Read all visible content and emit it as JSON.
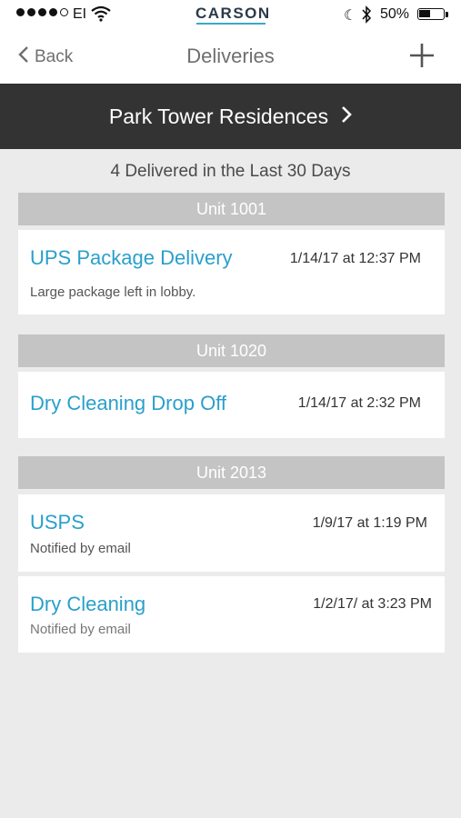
{
  "status_bar": {
    "carrier": "EI",
    "brand": "CARSON",
    "battery_percent": "50%",
    "battery_level": 0.5
  },
  "nav": {
    "back_label": "Back",
    "title": "Deliveries",
    "add_icon": "plus-icon"
  },
  "property": {
    "name": "Park Tower Residences"
  },
  "summary": "4 Delivered in the Last 30 Days",
  "units": [
    {
      "name": "Unit 1001",
      "deliveries": [
        {
          "title": "UPS Package Delivery",
          "time": "1/14/17 at 12:37 PM",
          "note": "Large package left in lobby."
        }
      ]
    },
    {
      "name": "Unit 1020",
      "deliveries": [
        {
          "title": "Dry Cleaning Drop Off",
          "time": "1/14/17 at 2:32 PM",
          "note": ""
        }
      ]
    },
    {
      "name": "Unit 2013",
      "deliveries": [
        {
          "title": "USPS",
          "time": "1/9/17 at 1:19 PM",
          "note": "Notified by email"
        },
        {
          "title": "Dry Cleaning",
          "time": "1/2/17/ at 3:23 PM",
          "note": "Notified by email"
        }
      ]
    }
  ],
  "colors": {
    "accent": "#2a9fcb",
    "banner": "#333333",
    "unit_header": "#c4c4c4",
    "background": "#ebebeb"
  }
}
